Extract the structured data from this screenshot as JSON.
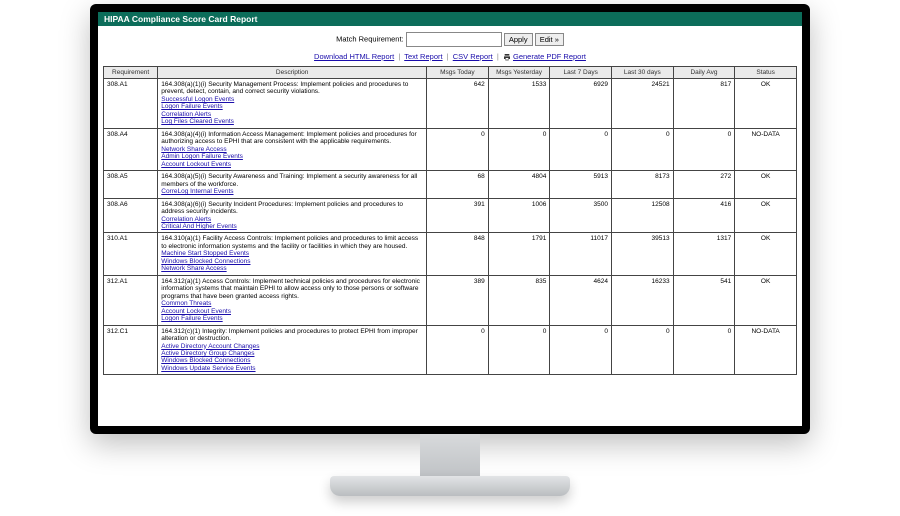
{
  "header": {
    "title": "HIPAA Compliance Score Card Report"
  },
  "filter": {
    "label": "Match Requirement:",
    "value": "",
    "apply": "Apply",
    "edit": "Edit »"
  },
  "links": {
    "html": "Download HTML Report",
    "text": "Text Report",
    "csv": "CSV Report",
    "pdf": "Generate PDF Report"
  },
  "table": {
    "columns": [
      "Requirement",
      "Description",
      "Msgs Today",
      "Msgs Yesterday",
      "Last 7 Days",
      "Last 30 days",
      "Daily Avg",
      "Status"
    ],
    "rows": [
      {
        "req": "308.A1",
        "desc": "164.308(a)(1)(i) Security Management Process: Implement policies and procedures to prevent, detect, contain, and correct security violations.",
        "links": [
          "Successful Logon Events",
          "Logon Failure Events",
          "Correlation Alerts",
          "Log Files Cleared Events"
        ],
        "today": 642,
        "yest": 1533,
        "d7": 6929,
        "d30": 24521,
        "avg": 817,
        "status": "OK"
      },
      {
        "req": "308.A4",
        "desc": "164.308(a)(4)(i) Information Access Management: Implement policies and procedures for authorizing access to EPHI that are consistent with the applicable requirements.",
        "links": [
          "Network Share Access",
          "Admin Logon Failure Events",
          "Account Lockout Events"
        ],
        "today": 0,
        "yest": 0,
        "d7": 0,
        "d30": 0,
        "avg": 0,
        "status": "NO-DATA"
      },
      {
        "req": "308.A5",
        "desc": "164.308(a)(5)(i) Security Awareness and Training: Implement a security awareness for all members of the workforce.",
        "links": [
          "CorreLog Internal Events"
        ],
        "today": 68,
        "yest": 4804,
        "d7": 5913,
        "d30": 8173,
        "avg": 272,
        "status": "OK"
      },
      {
        "req": "308.A6",
        "desc": "164.308(a)(6)(i) Security Incident Procedures: Implement policies and procedures to address security incidents.",
        "links": [
          "Correlation Alerts",
          "Critical And Higher Events"
        ],
        "today": 391,
        "yest": 1006,
        "d7": 3500,
        "d30": 12508,
        "avg": 416,
        "status": "OK"
      },
      {
        "req": "310.A1",
        "desc": "164.310(a)(1) Facility Access Controls: Implement policies and procedures to limit access to electronic information systems and the facility or facilities in which they are housed.",
        "links": [
          "Machine Start Stopped Events",
          "Windows Blocked Connections",
          "Network Share Access"
        ],
        "today": 848,
        "yest": 1791,
        "d7": 11017,
        "d30": 39513,
        "avg": 1317,
        "status": "OK"
      },
      {
        "req": "312.A1",
        "desc": "164.312(a)(1) Access Controls: Implement technical policies and procedures for electronic information systems that maintain EPHI to allow access only to those persons or software programs that have been granted access rights.",
        "links": [
          "Common Threats",
          "Account Lockout Events",
          "Logon Failure Events"
        ],
        "today": 389,
        "yest": 835,
        "d7": 4624,
        "d30": 16233,
        "avg": 541,
        "status": "OK"
      },
      {
        "req": "312.C1",
        "desc": "164.312(c)(1) Integrity: Implement policies and procedures to protect EPHI from improper alteration or destruction.",
        "links": [
          "Active Directory Account Changes",
          "Active Directory Group Changes",
          "Windows Blocked Connections",
          "Windows Update Service Events"
        ],
        "today": 0,
        "yest": 0,
        "d7": 0,
        "d30": 0,
        "avg": 0,
        "status": "NO-DATA"
      }
    ]
  }
}
